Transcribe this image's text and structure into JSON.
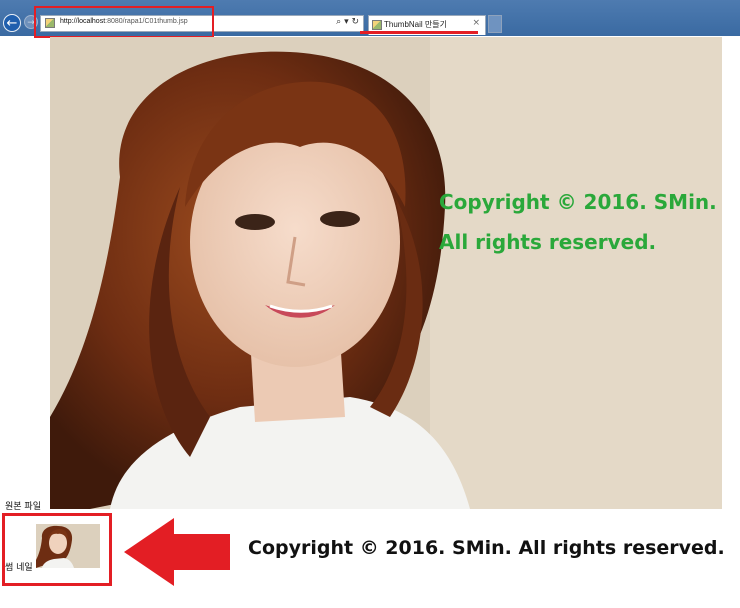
{
  "browser": {
    "url_host": "http://localhost",
    "url_rest": ":8080/rapa1/C01thumb.jsp",
    "address_tools": "⌕ ▾ ↻",
    "tab_title": "ThumbNail 만들기",
    "tab_close": "×",
    "back_glyph": "←",
    "forward_glyph": "→"
  },
  "watermark": {
    "line1": "Copyright © 2016. SMin.",
    "line2": "All rights reserved."
  },
  "labels": {
    "original_file": "원본 파일",
    "thumbnail": "썸 네일"
  },
  "annotation": {
    "bottom_text": "Copyright © 2016. SMin. All rights reserved."
  },
  "colors": {
    "watermark_green": "#2aa83a",
    "highlight_red": "#e31e24"
  }
}
